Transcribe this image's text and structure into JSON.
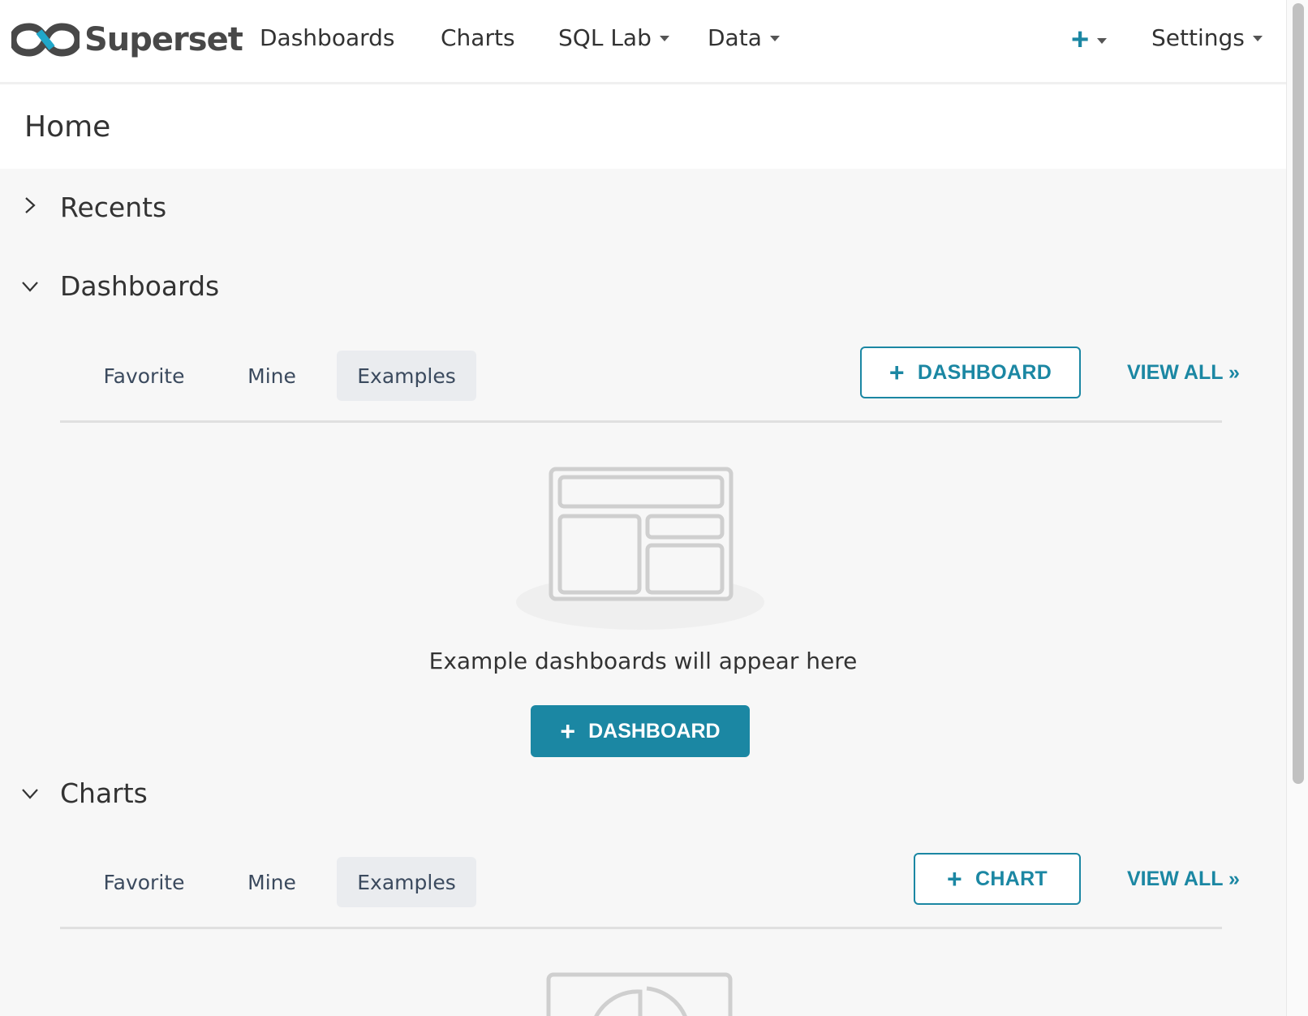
{
  "navbar": {
    "brand": "Superset",
    "links": [
      {
        "label": "Dashboards"
      },
      {
        "label": "Charts"
      },
      {
        "label": "SQL Lab"
      },
      {
        "label": "Data"
      }
    ],
    "settings_label": "Settings",
    "accent_color": "#1b87a3"
  },
  "page": {
    "title": "Home"
  },
  "sections": {
    "recents": {
      "title": "Recents",
      "expanded": false
    },
    "dashboards": {
      "title": "Dashboards",
      "expanded": true,
      "tabs": [
        "Favorite",
        "Mine",
        "Examples"
      ],
      "active_tab": "Examples",
      "add_label": "DASHBOARD",
      "view_all": "VIEW ALL »",
      "empty_text": "Example dashboards will appear here",
      "empty_button": "DASHBOARD"
    },
    "charts": {
      "title": "Charts",
      "expanded": true,
      "tabs": [
        "Favorite",
        "Mine",
        "Examples"
      ],
      "active_tab": "Examples",
      "add_label": "CHART",
      "view_all": "VIEW ALL »"
    }
  }
}
